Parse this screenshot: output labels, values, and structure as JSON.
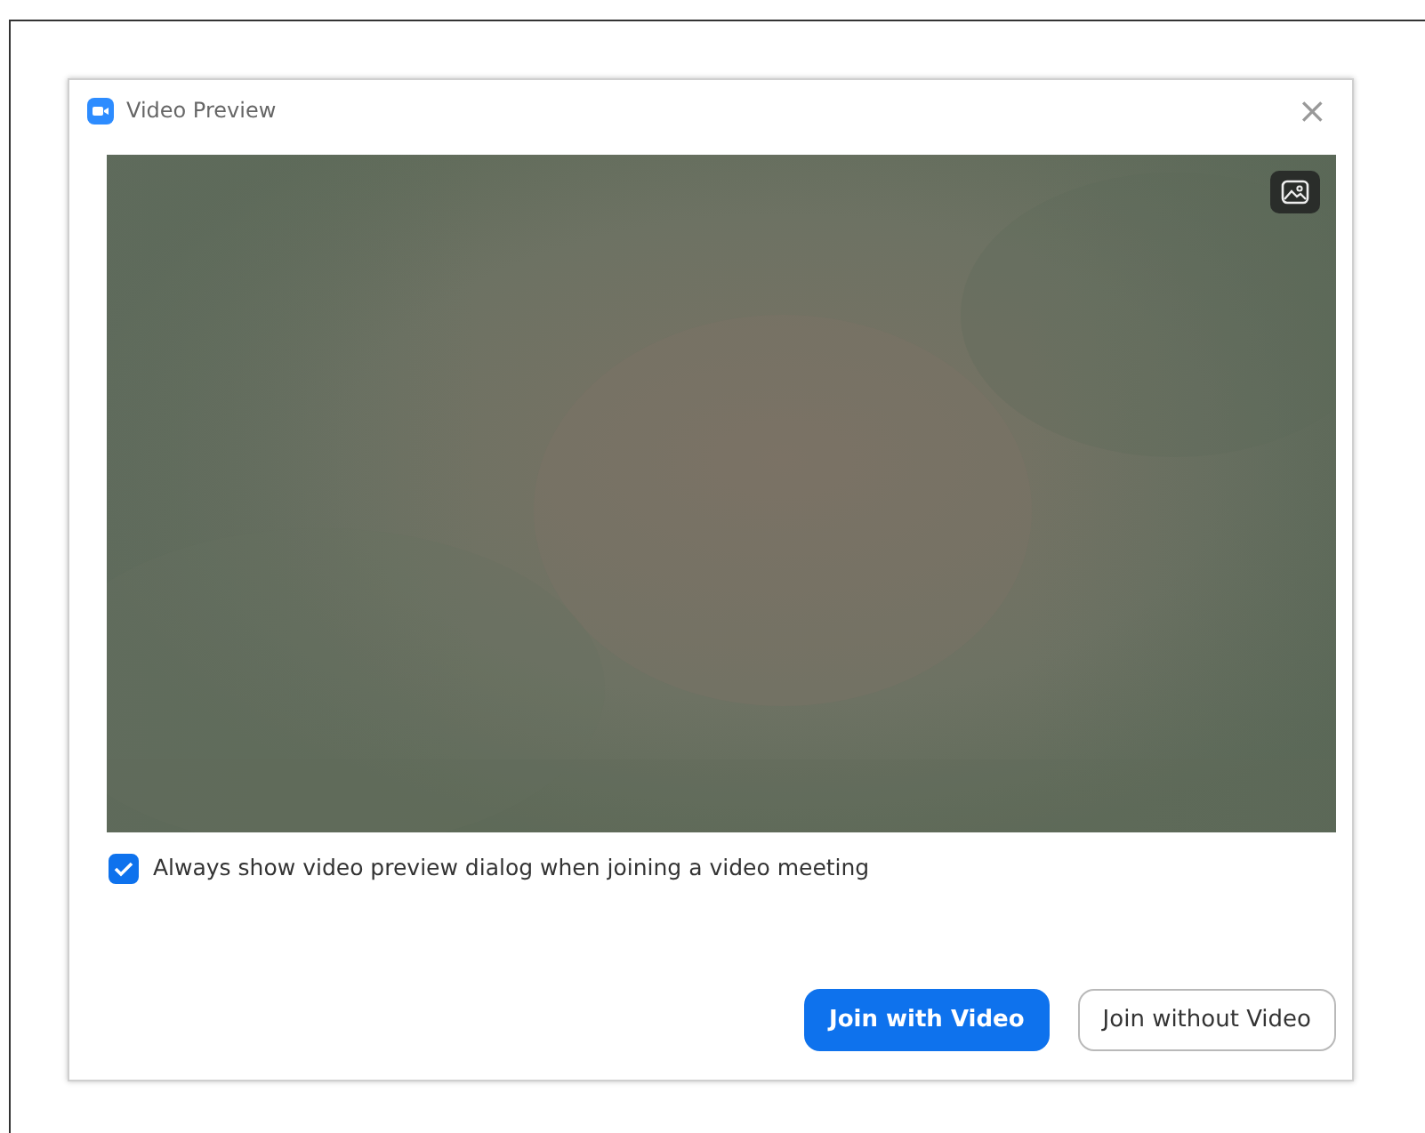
{
  "window": {
    "title": "Video Preview",
    "close": "×"
  },
  "always_show": {
    "label": "Always show video preview dialog when joining a video meeting",
    "checked": true
  },
  "buttons": [
    {
      "label": "Join with Video",
      "kind": "primary"
    },
    {
      "label": "Join without Video",
      "kind": "secondary"
    }
  ]
}
